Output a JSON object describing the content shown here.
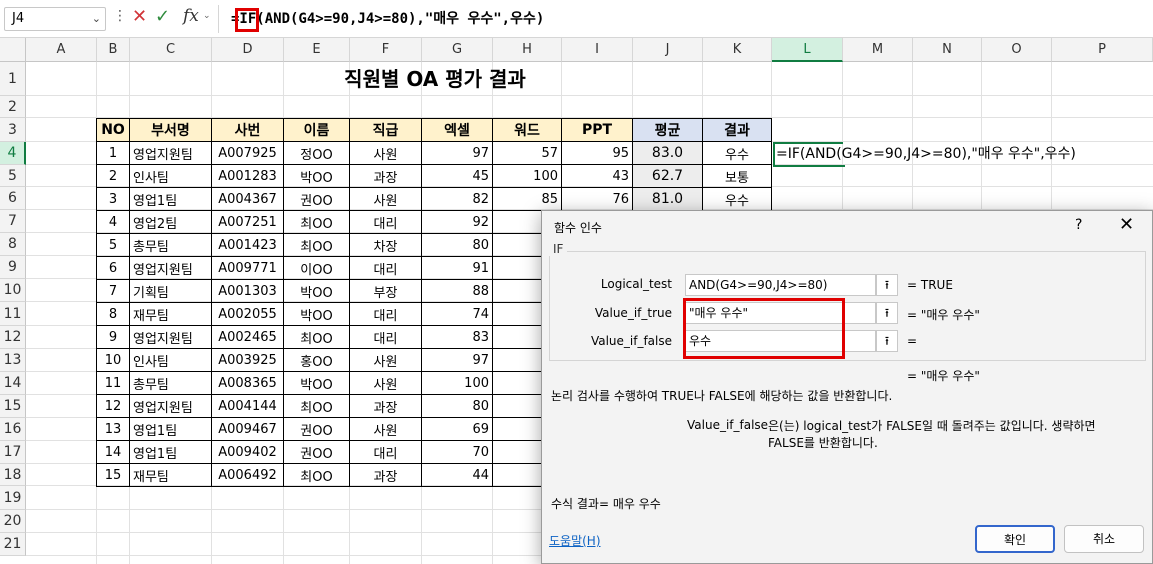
{
  "formula_bar": {
    "name_box": "J4",
    "formula": "=IF(AND(G4>=90,J4>=80),\"매우 우수\",우수)"
  },
  "columns": [
    "A",
    "B",
    "C",
    "D",
    "E",
    "F",
    "G",
    "H",
    "I",
    "J",
    "K",
    "L",
    "M",
    "N",
    "O",
    "P"
  ],
  "rows": [
    "1",
    "2",
    "3",
    "4",
    "5",
    "6",
    "7",
    "8",
    "9",
    "10",
    "11",
    "12",
    "13",
    "14",
    "15",
    "16",
    "17",
    "18",
    "19",
    "20",
    "21"
  ],
  "sheet_title": "직원별 OA 평가 결과",
  "table": {
    "headers": [
      "NO",
      "부서명",
      "사번",
      "이름",
      "직급",
      "엑셀",
      "워드",
      "PPT",
      "평균",
      "결과"
    ],
    "rows": [
      [
        "1",
        "영업지원팀",
        "A007925",
        "정OO",
        "사원",
        "97",
        "57",
        "95",
        "83.0",
        "우수"
      ],
      [
        "2",
        "인사팀",
        "A001283",
        "박OO",
        "과장",
        "45",
        "100",
        "43",
        "62.7",
        "보통"
      ],
      [
        "3",
        "영업1팀",
        "A004367",
        "권OO",
        "사원",
        "82",
        "85",
        "76",
        "81.0",
        "우수"
      ],
      [
        "4",
        "영업2팀",
        "A007251",
        "최OO",
        "대리",
        "92",
        "",
        "",
        "",
        ""
      ],
      [
        "5",
        "총무팀",
        "A001423",
        "최OO",
        "차장",
        "80",
        "",
        "",
        "",
        ""
      ],
      [
        "6",
        "영업지원팀",
        "A009771",
        "이OO",
        "대리",
        "91",
        "",
        "",
        "",
        ""
      ],
      [
        "7",
        "기획팀",
        "A001303",
        "박OO",
        "부장",
        "88",
        "",
        "",
        "",
        ""
      ],
      [
        "8",
        "재무팀",
        "A002055",
        "박OO",
        "대리",
        "74",
        "",
        "",
        "",
        ""
      ],
      [
        "9",
        "영업지원팀",
        "A002465",
        "최OO",
        "대리",
        "83",
        "",
        "",
        "",
        ""
      ],
      [
        "10",
        "인사팀",
        "A003925",
        "홍OO",
        "사원",
        "97",
        "",
        "",
        "",
        ""
      ],
      [
        "11",
        "총무팀",
        "A008365",
        "박OO",
        "사원",
        "100",
        "",
        "",
        "",
        ""
      ],
      [
        "12",
        "영업지원팀",
        "A004144",
        "최OO",
        "과장",
        "80",
        "",
        "",
        "",
        ""
      ],
      [
        "13",
        "영업1팀",
        "A009467",
        "권OO",
        "사원",
        "69",
        "",
        "",
        "",
        ""
      ],
      [
        "14",
        "영업1팀",
        "A009402",
        "권OO",
        "대리",
        "70",
        "",
        "",
        "",
        ""
      ],
      [
        "15",
        "재무팀",
        "A006492",
        "최OO",
        "과장",
        "44",
        "",
        "",
        "",
        ""
      ]
    ]
  },
  "l4_formula_text": "=IF(AND(G4>=90,J4>=80),\"매우 우수\",우수)",
  "dialog": {
    "title": "함수 인수",
    "help": "?",
    "close": "✕",
    "function_name": "IF",
    "args": [
      {
        "label": "Logical_test",
        "value": "AND(G4>=90,J4>=80)",
        "result": "=  TRUE"
      },
      {
        "label": "Value_if_true",
        "value": "\"매우 우수\"",
        "result": "=  \"매우 우수\""
      },
      {
        "label": "Value_if_false",
        "value": "우수",
        "result": "="
      }
    ],
    "overall_result": "=  \"매우 우수\"",
    "description": "논리 검사를 수행하여 TRUE나 FALSE에 해당하는 값을 반환합니다.",
    "arg_name": "Value_if_false",
    "arg_description": "은(는) logical_test가 FALSE일 때 돌려주는 값입니다. 생략하면 FALSE를 반환합니다.",
    "formula_result": "수식 결과=   매우 우수",
    "help_link": "도움말(H)",
    "ok": "확인",
    "cancel": "취소"
  }
}
